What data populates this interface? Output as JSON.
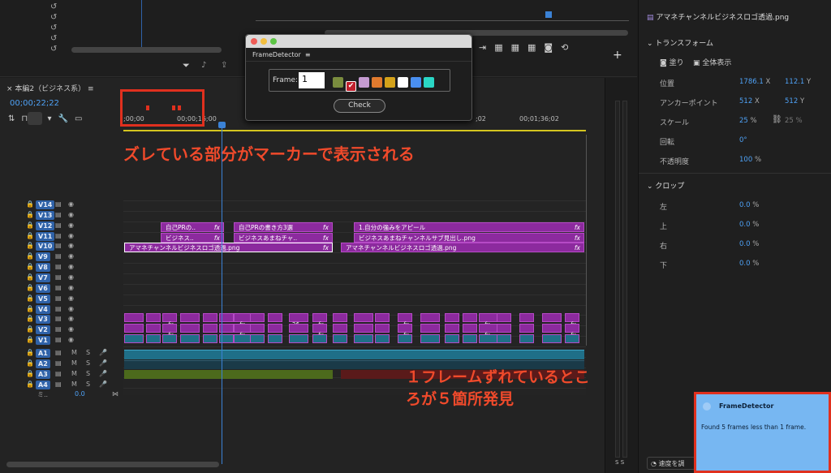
{
  "app": {
    "accent": "#2f62a8"
  },
  "dialog": {
    "title": "FrameDetector",
    "menu_icon": "≡",
    "frame_label": "Frame:",
    "frame_value": "1",
    "check_button": "Check",
    "swatches": [
      "#7a8c3e",
      "#c0202d",
      "#c59bd1",
      "#e07a2e",
      "#d4a21a",
      "#ffffff",
      "#4a8ff0",
      "#2ad6c5"
    ]
  },
  "timeline": {
    "sequence_tab": "本編2（ビジネス系）",
    "timecode": "00;00;22;22",
    "ruler": [
      ";00;00",
      "00;00;16;00",
      ";02",
      "00;01;36;02"
    ],
    "video_tracks": [
      "V14",
      "V13",
      "V12",
      "V11",
      "V10",
      "V9",
      "V8",
      "V7",
      "V6",
      "V5",
      "V4",
      "V3",
      "V2",
      "V1"
    ],
    "audio_tracks": [
      "A1",
      "A2",
      "A3",
      "A4"
    ],
    "mix_label": "ミ..",
    "mix_value": "0.0",
    "clips": {
      "v12_a": "自己PRの..",
      "v12_b": "自己PRの書き方3選",
      "v12_c": "1.自分の強みをアピール",
      "v11_a": "ビジネス..",
      "v11_b": "ビジネスあまねチャ..",
      "v11_c": "ビジネスあまねチャンネルサブ見出し.png",
      "v10_a": "アマネチャンネルビジネスロゴ透過.png",
      "v10_b": "アマネチャンネルビジネスロゴ透過.png",
      "v3_a": "26..",
      "fx": "fx"
    },
    "track_controls": {
      "m": "M",
      "s": "S"
    }
  },
  "annotations": {
    "markers_note": "ズレている部分がマーカーで表示される",
    "found_note": "１フレームずれているところが５箇所発見"
  },
  "notice": {
    "title": "FrameDetector",
    "message": "Found 5 frames less than 1 frame."
  },
  "effect_controls": {
    "clip_name": "アマネチャンネルビジネスロゴ透過.png",
    "transform": "トランスフォーム",
    "fill": "塗り",
    "show_all": "全体表示",
    "position": "位置",
    "position_x": "1786.1",
    "position_y": "112.1",
    "anchor": "アンカーポイント",
    "anchor_x": "512",
    "anchor_y": "512",
    "scale": "スケール",
    "scale_val": "25",
    "scale_val2": "25",
    "rotation": "回転",
    "rotation_val": "0",
    "opacity": "不透明度",
    "opacity_val": "100",
    "crop": "クロップ",
    "left": "左",
    "top": "上",
    "right": "右",
    "bottom": "下",
    "crop_val": "0.0",
    "x": "X",
    "y": "Y",
    "pct": "%",
    "deg": "°",
    "speed_label": "速度を調"
  },
  "meter": {
    "s1": "S",
    "s2": "S"
  }
}
